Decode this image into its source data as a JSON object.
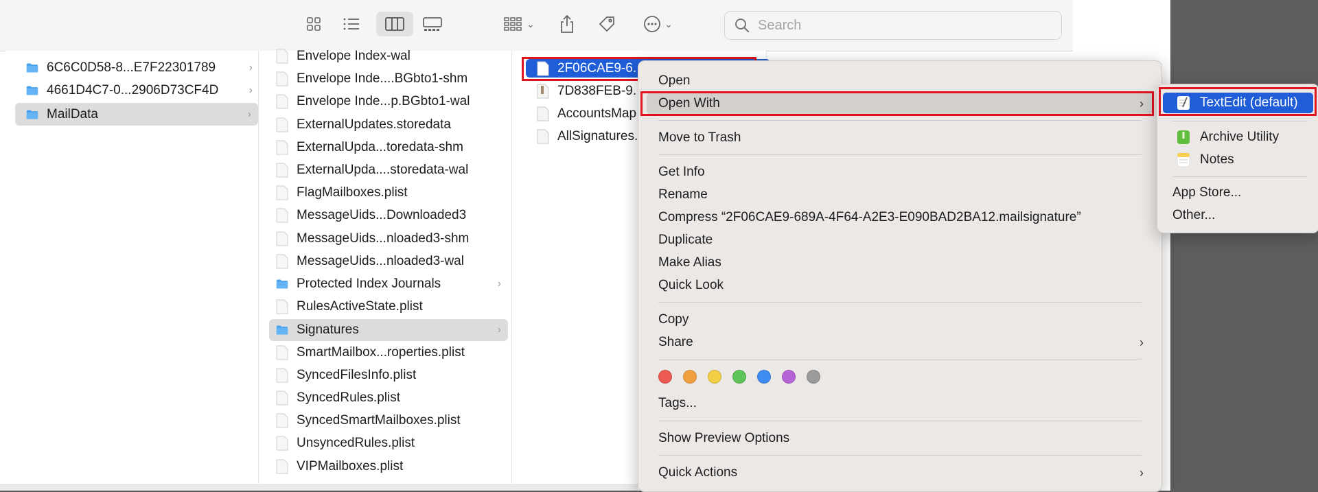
{
  "toolbar": {
    "search_placeholder": "Search"
  },
  "column1": {
    "items": [
      {
        "label": "6C6C0D58-8...E7F22301789",
        "type": "folder"
      },
      {
        "label": "4661D4C7-0...2906D73CF4D",
        "type": "folder"
      },
      {
        "label": "MailData",
        "type": "folder",
        "selected": true
      }
    ]
  },
  "column2": {
    "items": [
      {
        "label": "Envelope Index-wal",
        "type": "file"
      },
      {
        "label": "Envelope Inde....BGbto1-shm",
        "type": "file"
      },
      {
        "label": "Envelope Inde...p.BGbto1-wal",
        "type": "file"
      },
      {
        "label": "ExternalUpdates.storedata",
        "type": "file"
      },
      {
        "label": "ExternalUpda...toredata-shm",
        "type": "file"
      },
      {
        "label": "ExternalUpda....storedata-wal",
        "type": "file"
      },
      {
        "label": "FlagMailboxes.plist",
        "type": "file"
      },
      {
        "label": "MessageUids...Downloaded3",
        "type": "file"
      },
      {
        "label": "MessageUids...nloaded3-shm",
        "type": "file"
      },
      {
        "label": "MessageUids...nloaded3-wal",
        "type": "file"
      },
      {
        "label": "Protected Index Journals",
        "type": "folder"
      },
      {
        "label": "RulesActiveState.plist",
        "type": "file"
      },
      {
        "label": "Signatures",
        "type": "folder",
        "selected": true
      },
      {
        "label": "SmartMailbox...roperties.plist",
        "type": "file"
      },
      {
        "label": "SyncedFilesInfo.plist",
        "type": "file"
      },
      {
        "label": "SyncedRules.plist",
        "type": "file"
      },
      {
        "label": "SyncedSmartMailboxes.plist",
        "type": "file"
      },
      {
        "label": "UnsyncedRules.plist",
        "type": "file"
      },
      {
        "label": "VIPMailboxes.plist",
        "type": "file"
      }
    ]
  },
  "column3": {
    "items": [
      {
        "label": "2F06CAE9-6.",
        "type": "file",
        "selected": true
      },
      {
        "label": "7D838FEB-9.",
        "type": "archive"
      },
      {
        "label": "AccountsMap",
        "type": "file"
      },
      {
        "label": "AllSignatures.",
        "type": "file"
      }
    ]
  },
  "context_menu": {
    "open": "Open",
    "open_with": "Open With",
    "move_to_trash": "Move to Trash",
    "get_info": "Get Info",
    "rename": "Rename",
    "compress": "Compress “2F06CAE9-689A-4F64-A2E3-E090BAD2BA12.mailsignature”",
    "duplicate": "Duplicate",
    "make_alias": "Make Alias",
    "quick_look": "Quick Look",
    "copy": "Copy",
    "share": "Share",
    "tags": "Tags...",
    "show_preview_options": "Show Preview Options",
    "quick_actions": "Quick Actions",
    "tag_colors": [
      "#ec5b52",
      "#f0a040",
      "#f3cf45",
      "#5ec45a",
      "#3f8cf2",
      "#b565d6",
      "#9b9b9b"
    ]
  },
  "open_with_submenu": {
    "textedit": "TextEdit (default)",
    "archive_utility": "Archive Utility",
    "notes": "Notes",
    "app_store": "App Store...",
    "other": "Other..."
  }
}
